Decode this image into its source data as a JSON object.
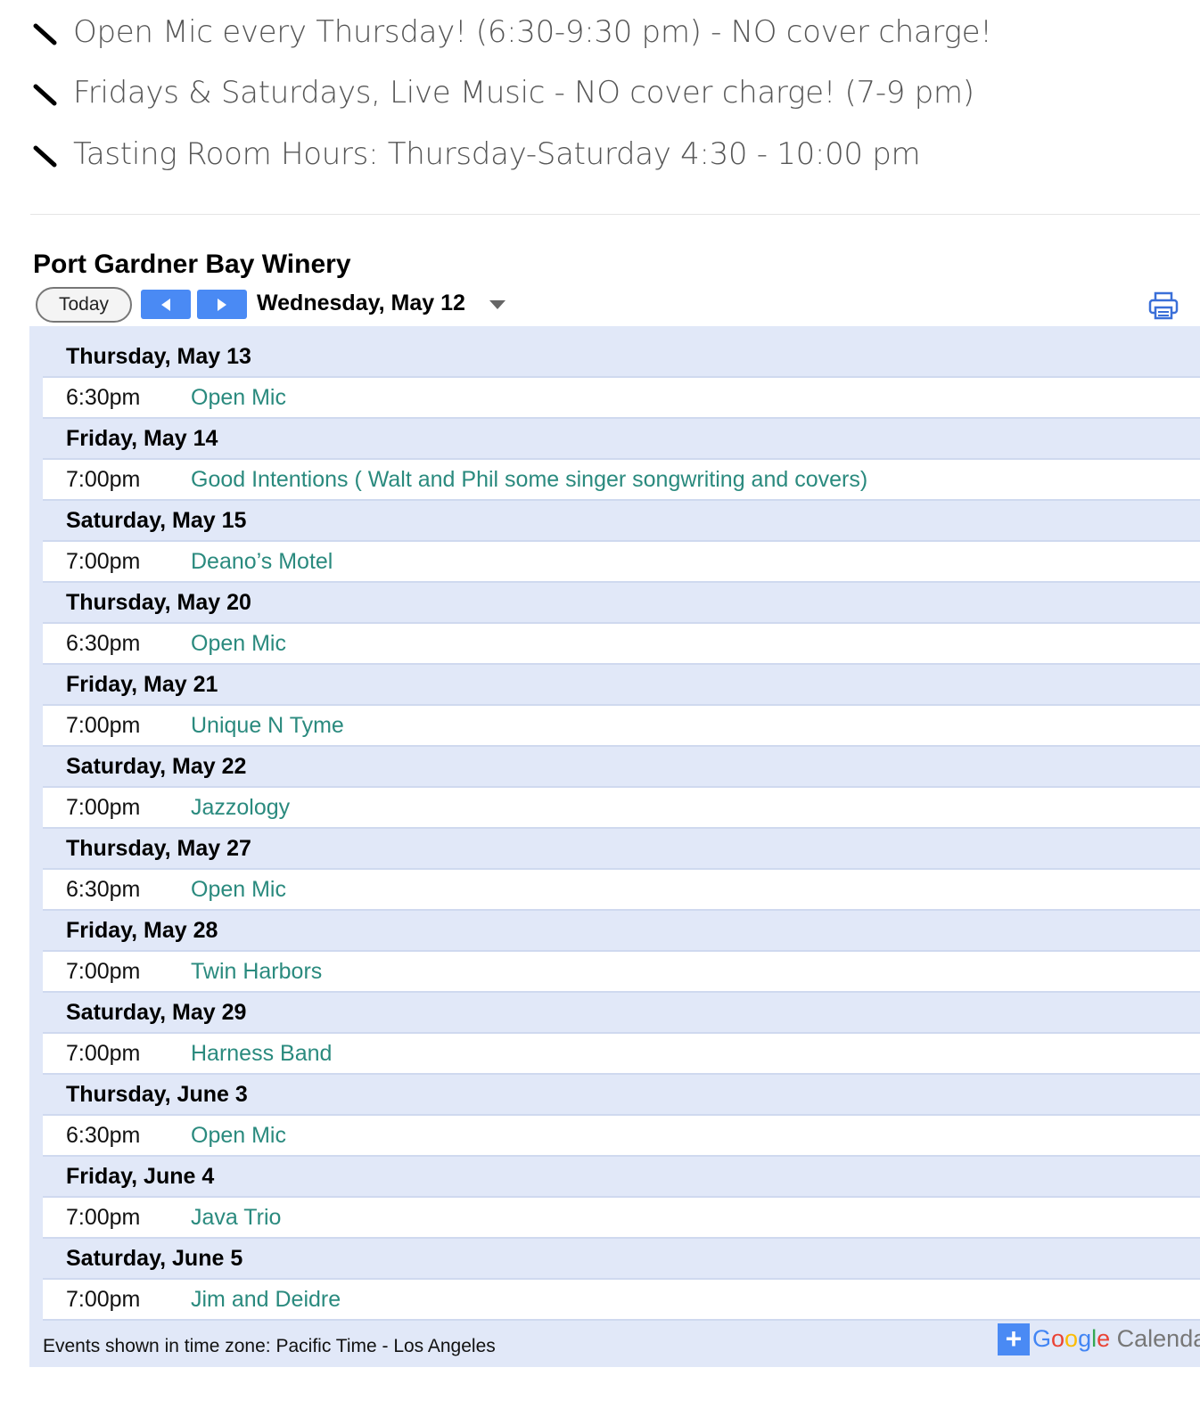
{
  "announcements": [
    "Open Mic every Thursday! (6:30-9:30 pm) - NO cover charge!",
    "Fridays & Saturdays, Live Music - NO cover charge! (7-9 pm)",
    "Tasting Room Hours: Thursday-Saturday 4:30 - 10:00 pm"
  ],
  "calendar": {
    "title": "Port Gardner Bay Winery",
    "today_label": "Today",
    "current_date": "Wednesday, May 12",
    "accent_color": "#4a8af4",
    "event_color": "#2a8a7e",
    "days": [
      {
        "date": "Thursday, May 13",
        "time": "6:30pm",
        "event": "Open Mic"
      },
      {
        "date": "Friday, May 14",
        "time": "7:00pm",
        "event": "Good Intentions ( Walt and Phil some singer songwriting and covers)"
      },
      {
        "date": "Saturday, May 15",
        "time": "7:00pm",
        "event": "Deano’s Motel"
      },
      {
        "date": "Thursday, May 20",
        "time": "6:30pm",
        "event": "Open Mic"
      },
      {
        "date": "Friday, May 21",
        "time": "7:00pm",
        "event": "Unique N Tyme"
      },
      {
        "date": "Saturday, May 22",
        "time": "7:00pm",
        "event": "Jazzology"
      },
      {
        "date": "Thursday, May 27",
        "time": "6:30pm",
        "event": "Open Mic"
      },
      {
        "date": "Friday, May 28",
        "time": "7:00pm",
        "event": "Twin Harbors"
      },
      {
        "date": "Saturday, May 29",
        "time": "7:00pm",
        "event": "Harness Band"
      },
      {
        "date": "Thursday, June 3",
        "time": "6:30pm",
        "event": "Open Mic"
      },
      {
        "date": "Friday, June 4",
        "time": "7:00pm",
        "event": "Java Trio"
      },
      {
        "date": "Saturday, June 5",
        "time": "7:00pm",
        "event": "Jim and Deidre"
      }
    ],
    "timezone_note": "Events shown in time zone: Pacific Time - Los Angeles",
    "badge": {
      "plus": "+",
      "text": "Google Calendar"
    }
  }
}
